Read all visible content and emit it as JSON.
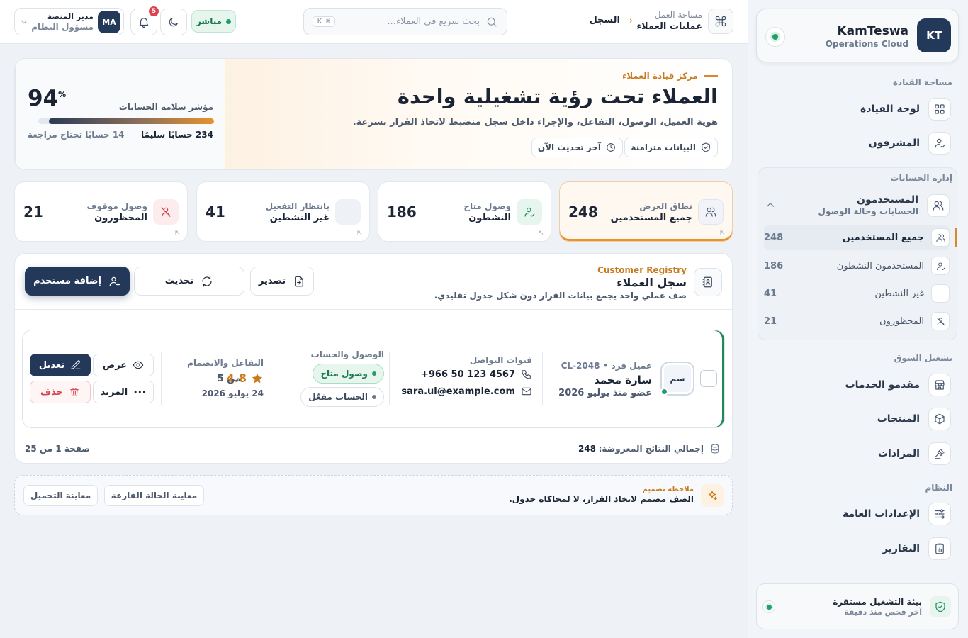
{
  "brand": {
    "logo": "KT",
    "name": "KamTeswa",
    "sub": "Operations Cloud"
  },
  "sidebar": {
    "sections": {
      "command": "مساحة القيادة",
      "accounts": "إدارة الحسابات",
      "market": "تشغيل السوق",
      "system": "النظام"
    },
    "items": {
      "dashboard": "لوحة القيادة",
      "supervisors": "المشرفون",
      "users_title": "المستخدمون",
      "users_sub": "الحسابات وحالة الوصول",
      "providers": "مقدمو الخدمات",
      "products": "المنتجات",
      "auctions": "المزادات",
      "settings": "الإعدادات العامة",
      "reports": "التقارير"
    },
    "sub_items": [
      {
        "label": "جميع المستخدمين",
        "count": "248"
      },
      {
        "label": "المستخدمون النشطون",
        "count": "186"
      },
      {
        "label": "غير النشطين",
        "count": "41"
      },
      {
        "label": "المحظورون",
        "count": "21"
      }
    ],
    "env": {
      "title": "بيئة التشغيل مستقرة",
      "sub": "آخر فحص منذ دقيقة"
    }
  },
  "topbar": {
    "crumb_parent": "مساحة العمل",
    "crumb_section": "عمليات العملاء",
    "crumb_current": "السجل",
    "search_placeholder": "بحث سريع في العملاء...",
    "search_kbd": "⌘ K",
    "live": "مباشر",
    "notifications": "5",
    "user_initials": "MA",
    "user_name": "مدير المنصة",
    "user_role": "مسؤول النظام"
  },
  "hero": {
    "eyebrow": "مركز قيادة العملاء",
    "title": "العملاء تحت رؤية تشغيلية واحدة",
    "subtitle": "هوية العميل، الوصول، التفاعل، والإجراء داخل سجل منضبط لاتخاذ القرار بسرعة.",
    "chip_synced": "البيانات متزامنة",
    "chip_updated": "آخر تحديث الآن",
    "health_label": "مؤشر سلامة الحسابات",
    "health_value": "94",
    "health_unit": "%",
    "health_percent": 94,
    "health_ok": "234 حسابًا سليمًا",
    "health_review": "14 حسابًا تحتاج مراجعة"
  },
  "stats": [
    {
      "title": "نطاق العرض",
      "label": "جميع المستخدمين",
      "value": "248"
    },
    {
      "title": "وصول متاح",
      "label": "النشطون",
      "value": "186"
    },
    {
      "title": "بانتظار التفعيل",
      "label": "غير النشطين",
      "value": "41"
    },
    {
      "title": "وصول موقوف",
      "label": "المحظورون",
      "value": "21"
    }
  ],
  "registry": {
    "eyebrow": "Customer Registry",
    "title": "سجل العملاء",
    "subtitle": "صف عملي واحد يجمع بيانات القرار دون شكل جدول تقليدي.",
    "export": "تصدير",
    "refresh": "تحديث",
    "add_user": "إضافة مستخدم",
    "row": {
      "avatar": "سم",
      "meta": "عميل فرد • CL-2048",
      "name": "سارة محمد",
      "member_since": "عضو منذ يوليو 2026",
      "contact_label": "قنوات التواصل",
      "phone": "+966 50 123 4567",
      "email": "sara.ul@example.com",
      "access_label": "الوصول والحساب",
      "access_status": "وصول متاح",
      "account_status": "الحساب مفعّل",
      "engagement_label": "التفاعل والانضمام",
      "rating": "4.8",
      "rating_of": "من 5",
      "joined": "24 يوليو 2026",
      "view": "عرض",
      "edit": "تعديل",
      "more": "المزيد",
      "delete": "حذف"
    },
    "total_label": "إجمالي النتائج المعروضة:",
    "total_value": "248",
    "page_info": "صفحة 1 من 25"
  },
  "note": {
    "label": "ملاحظة تصميم",
    "text": "الصف مصمم لاتخاذ القرار، لا لمحاكاة جدول.",
    "empty_preview": "معاينة الحالة الفارغة",
    "loading_preview": "معاينة التحميل"
  },
  "colors": {
    "accent": "#d9892b",
    "primary": "#24395a",
    "success": "#22a06b",
    "danger": "#e0434f"
  }
}
